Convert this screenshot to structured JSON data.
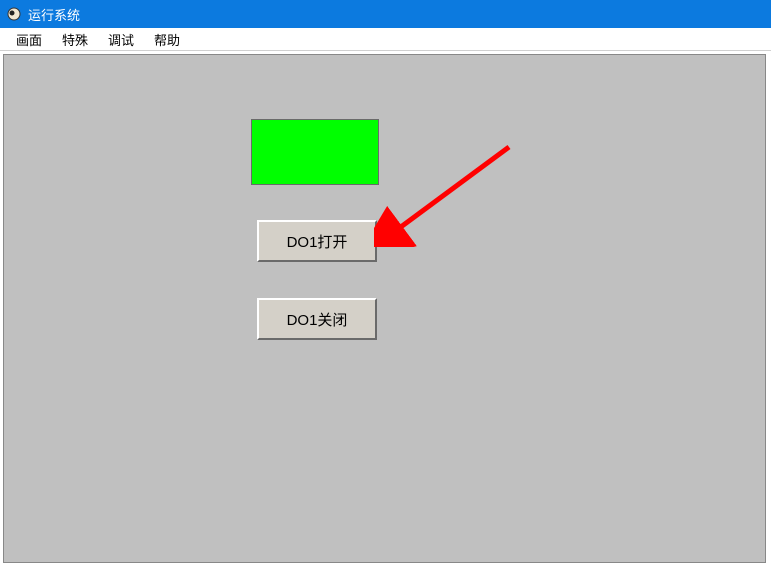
{
  "titleBar": {
    "title": "运行系统"
  },
  "menuBar": {
    "items": [
      {
        "label": "画面"
      },
      {
        "label": "特殊"
      },
      {
        "label": "调试"
      },
      {
        "label": "帮助"
      }
    ]
  },
  "content": {
    "indicatorColor": "#00ff00",
    "buttonOpenLabel": "DO1打开",
    "buttonCloseLabel": "DO1关闭"
  },
  "annotation": {
    "arrowColor": "#ff0000"
  }
}
